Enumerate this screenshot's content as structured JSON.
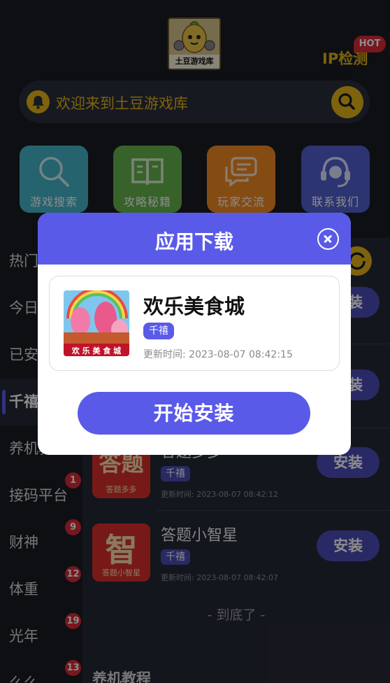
{
  "header": {
    "logo_caption": "土豆游戏库",
    "ip_check": "IP检测",
    "hot_badge": "HOT"
  },
  "search": {
    "text": "欢迎来到土豆游戏库"
  },
  "shortcuts": [
    {
      "label": "游戏搜索",
      "icon": "magnifier-icon"
    },
    {
      "label": "攻略秘籍",
      "icon": "book-icon"
    },
    {
      "label": "玩家交流",
      "icon": "chat-icon"
    },
    {
      "label": "联系我们",
      "icon": "headset-icon"
    }
  ],
  "sidebar": [
    {
      "label": "热门"
    },
    {
      "label": "今日"
    },
    {
      "label": "已安"
    },
    {
      "label": "千禧"
    },
    {
      "label": "养机教程"
    },
    {
      "label": "接码平台",
      "badge": "1"
    },
    {
      "label": "财神",
      "badge": "9"
    },
    {
      "label": "体重",
      "badge": "12"
    },
    {
      "label": "光年",
      "badge": "19"
    },
    {
      "label": "么么",
      "badge": "13"
    }
  ],
  "list": {
    "install_label": "安装",
    "items": [
      {
        "name": "",
        "tag": "",
        "time": ""
      },
      {
        "name": "",
        "tag": "",
        "time": ""
      },
      {
        "name": "答题多多",
        "tag": "千禧",
        "time": "更新时间: 2023-08-07 08:42:12",
        "icon_text": "答题",
        "icon_sub": "答题多多"
      },
      {
        "name": "答题小智星",
        "tag": "千禧",
        "time": "更新时间: 2023-08-07 08:42:07",
        "icon_text": "智",
        "icon_sub": "答题小智星"
      }
    ],
    "end_text": "- 到底了 -",
    "next_section": "养机教程"
  },
  "modal": {
    "title": "应用下载",
    "app_name": "欢乐美食城",
    "app_tag": "千禧",
    "app_time": "更新时间: 2023-08-07 08:42:15",
    "app_icon_text": "欢 乐 美 食 城",
    "start_button": "开始安装"
  },
  "colors": {
    "accent": "#5a5ae8",
    "gold": "#e6b419",
    "badge_red": "#d92b37"
  }
}
